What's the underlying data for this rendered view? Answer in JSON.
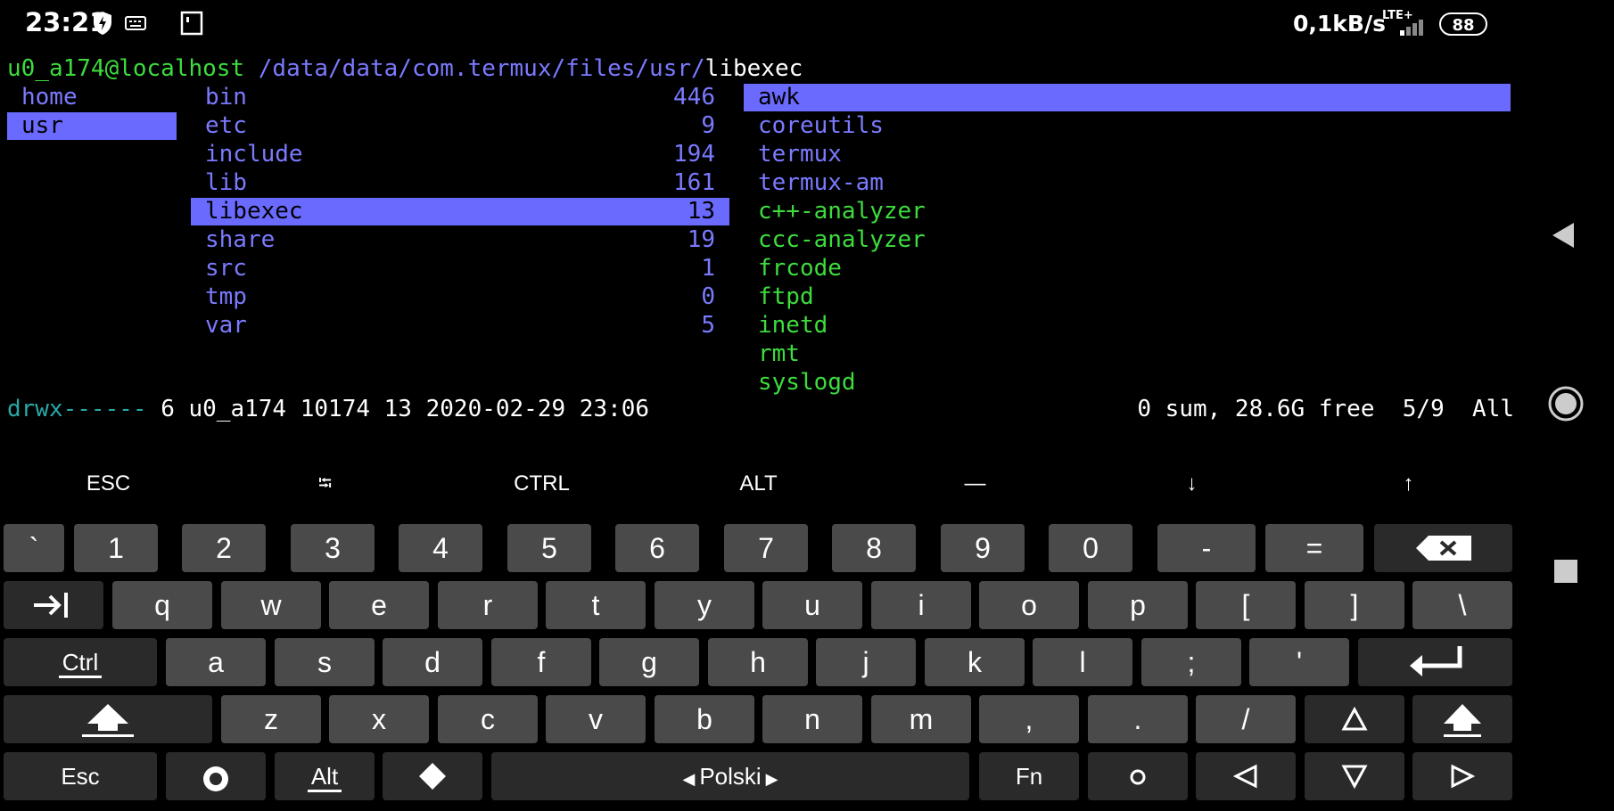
{
  "status": {
    "time": "23:21",
    "speed": "0,1kB/s",
    "network": "LTE+",
    "battery": "88"
  },
  "terminal": {
    "user": "u0_a174@localhost",
    "path": "/data/data/com.termux/files/usr/",
    "current": "libexec",
    "parent": [
      "home",
      "usr"
    ],
    "dirs": [
      {
        "name": "bin",
        "count": "446"
      },
      {
        "name": "etc",
        "count": "9"
      },
      {
        "name": "include",
        "count": "194"
      },
      {
        "name": "lib",
        "count": "161"
      },
      {
        "name": "libexec",
        "count": "13"
      },
      {
        "name": "share",
        "count": "19"
      },
      {
        "name": "src",
        "count": "1"
      },
      {
        "name": "tmp",
        "count": "0"
      },
      {
        "name": "var",
        "count": "5"
      }
    ],
    "preview": [
      "awk",
      "coreutils",
      "termux",
      "termux-am",
      "c++-analyzer",
      "ccc-analyzer",
      "frcode",
      "ftpd",
      "inetd",
      "rmt",
      "syslogd"
    ],
    "status_perm": "drwx------",
    "status_info": " 6 u0_a174 10174 13 2020-02-29 23:06",
    "status_right": "0 sum, 28.6G free  5/9  All"
  },
  "extra_keys": [
    "ESC",
    "⭾",
    "CTRL",
    "ALT",
    "—",
    "↓",
    "↑"
  ],
  "keyboard": {
    "row1": [
      "`",
      "1",
      "2",
      "3",
      "4",
      "5",
      "6",
      "7",
      "8",
      "9",
      "0",
      "-",
      "="
    ],
    "row2": [
      "q",
      "w",
      "e",
      "r",
      "t",
      "y",
      "u",
      "i",
      "o",
      "p",
      "[",
      "]",
      "\\"
    ],
    "row3": [
      "a",
      "s",
      "d",
      "f",
      "g",
      "h",
      "j",
      "k",
      "l",
      ";",
      "'"
    ],
    "row4": [
      "z",
      "x",
      "c",
      "v",
      "b",
      "n",
      "m",
      ",",
      ".",
      "/"
    ],
    "ctrl": "Ctrl",
    "esc": "Esc",
    "alt": "Alt",
    "space": "Polski",
    "fn": "Fn"
  }
}
